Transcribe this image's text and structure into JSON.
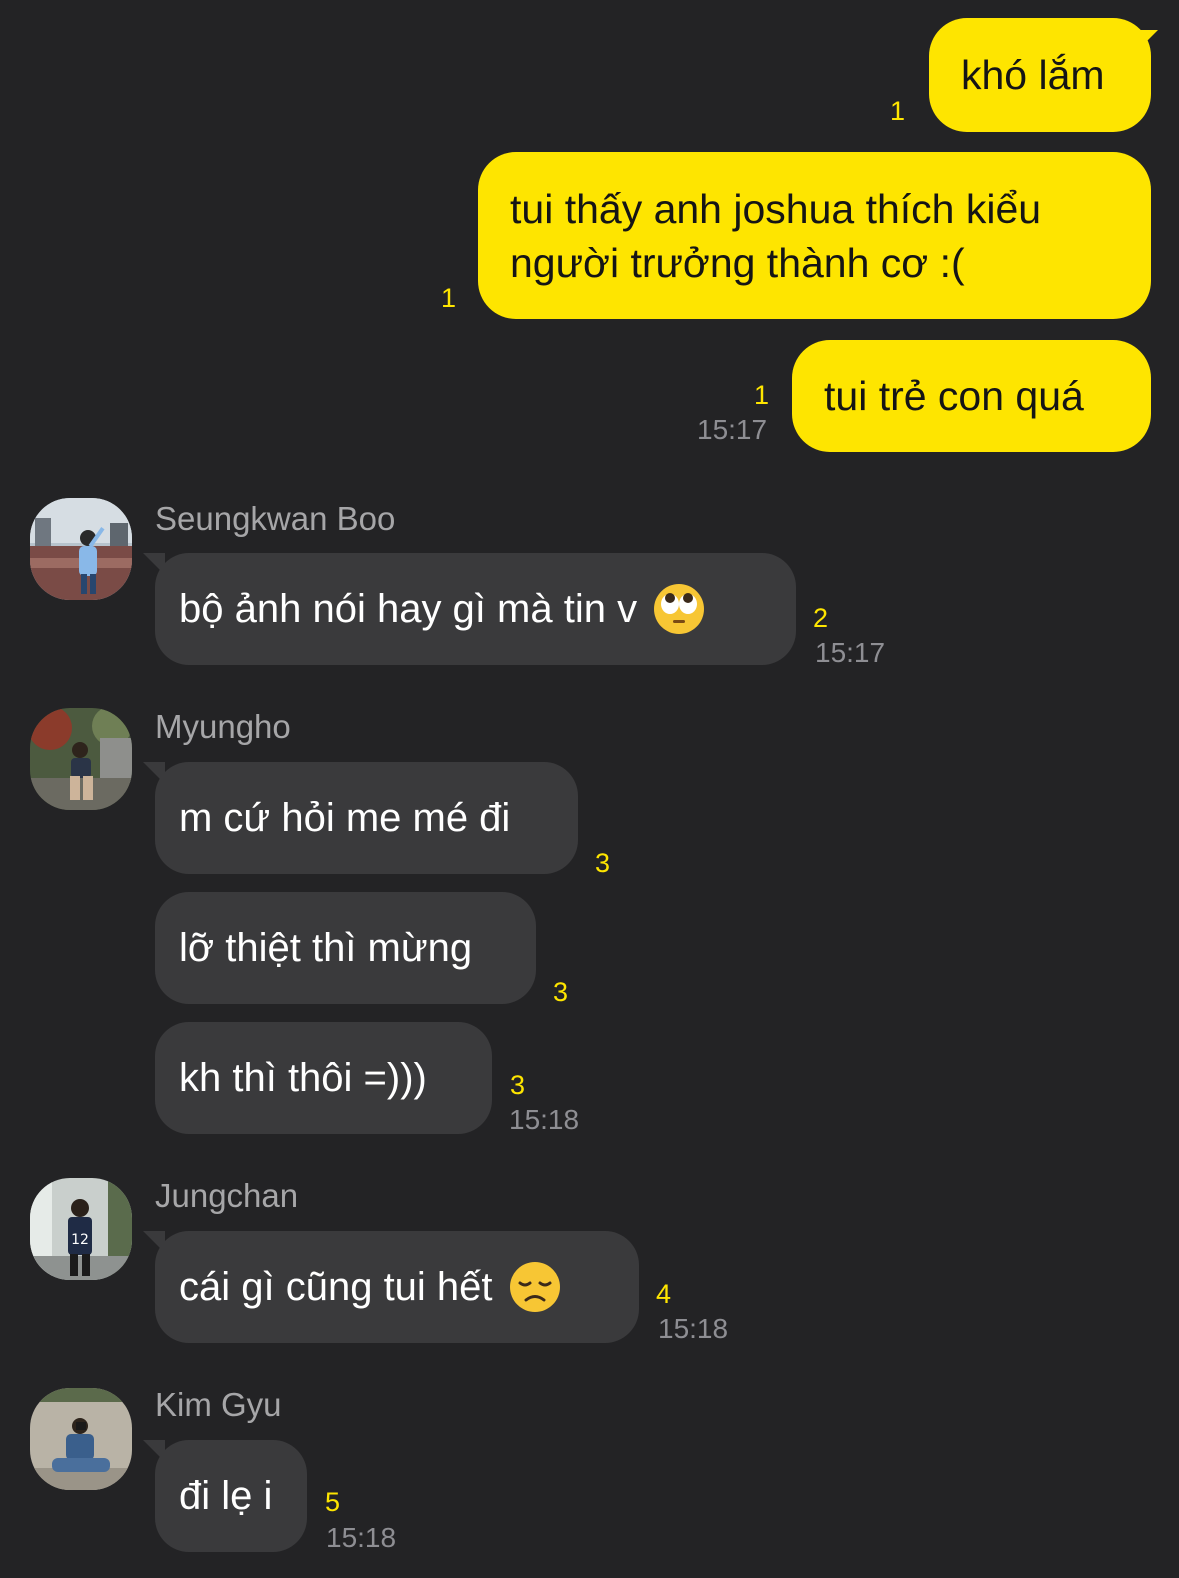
{
  "outgoing": [
    {
      "text": "khó lắm",
      "read_count": "1"
    },
    {
      "lines": [
        "tui thấy anh joshua thích kiểu",
        "người trưởng thành cơ :("
      ],
      "read_count": "1"
    },
    {
      "text": "tui trẻ con quá",
      "read_count": "1",
      "time": "15:17"
    }
  ],
  "groups": [
    {
      "sender": "Seungkwan Boo",
      "messages": [
        {
          "text": "bộ ảnh nói hay gì mà tin v",
          "emoji": "face-with-rolling-eyes-icon",
          "read_count": "2",
          "time": "15:17"
        }
      ]
    },
    {
      "sender": "Myungho",
      "messages": [
        {
          "text": "m cứ hỏi me mé đi",
          "read_count": "3"
        },
        {
          "text": "lỡ thiệt thì mừng",
          "read_count": "3"
        },
        {
          "text": "kh thì thôi =)))",
          "read_count": "3",
          "time": "15:18"
        }
      ]
    },
    {
      "sender": "Jungchan",
      "messages": [
        {
          "text": "cái gì cũng tui hết",
          "emoji": "disappointed-face-icon",
          "read_count": "4",
          "time": "15:18"
        }
      ]
    },
    {
      "sender": "Kim Gyu",
      "messages": [
        {
          "text": "đi lẹ i",
          "read_count": "5",
          "time": "15:18"
        }
      ]
    }
  ],
  "colors": {
    "background": "#232325",
    "outgoing_bubble": "#fee500",
    "incoming_bubble": "#3a3a3c",
    "read_count": "#fee500",
    "timestamp": "#8e8e93",
    "sender_name": "#a6a6a8"
  }
}
